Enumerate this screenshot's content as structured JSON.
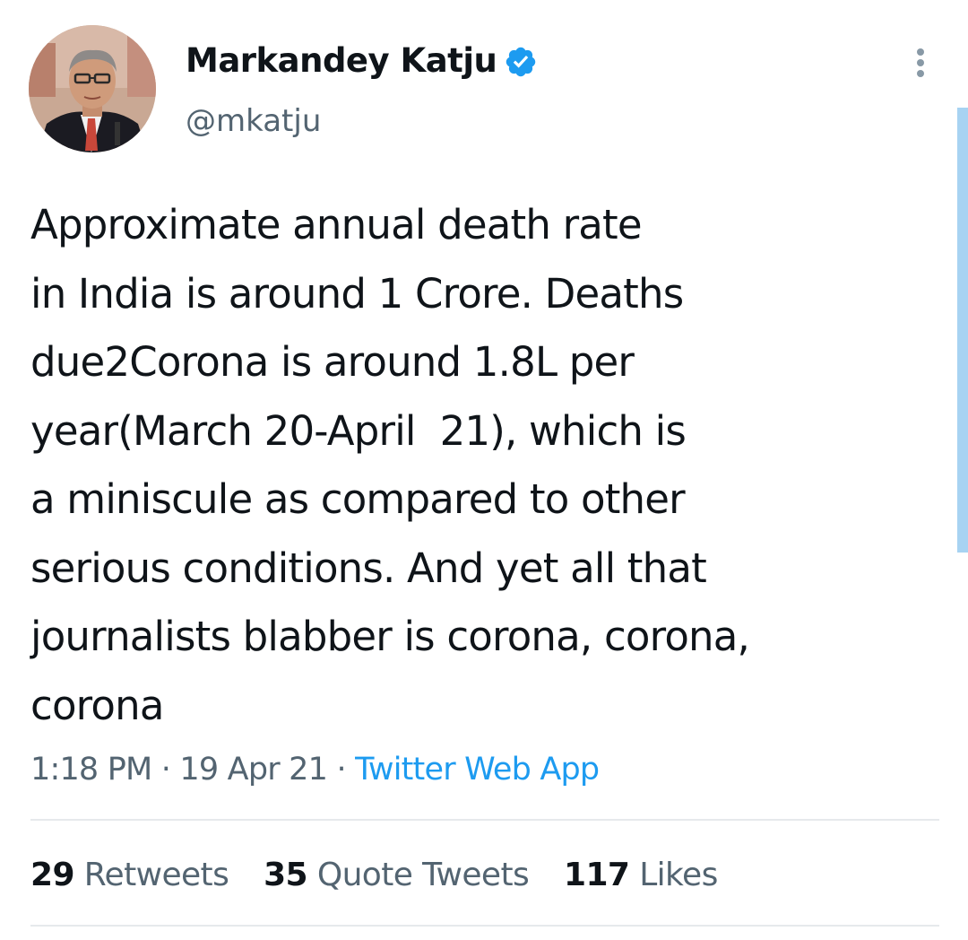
{
  "author": {
    "display_name": "Markandey Katju",
    "handle": "@mkatju",
    "verified": true
  },
  "tweet": {
    "lines": [
      "Approximate annual death rate",
      "in India is around 1 Crore. Deaths",
      "due2Corona is around 1.8L per",
      "year(March 20-April  21), which is",
      "a miniscule as compared to other",
      "serious conditions. And yet all that",
      "journalists blabber is corona, corona,",
      "corona"
    ],
    "time": "1:18 PM",
    "separator": "·",
    "date": "19 Apr 21",
    "source": "Twitter Web App"
  },
  "stats": {
    "retweets": {
      "count": "29",
      "label": "Retweets"
    },
    "quotes": {
      "count": "35",
      "label": "Quote Tweets"
    },
    "likes": {
      "count": "117",
      "label": "Likes"
    }
  },
  "icons": {
    "verified": "verified-badge-icon",
    "more": "more-vertical-icon"
  },
  "colors": {
    "text": "#0f1419",
    "secondary": "#536471",
    "link": "#1d9bf0",
    "scrollbar": "#a7d3f2"
  }
}
